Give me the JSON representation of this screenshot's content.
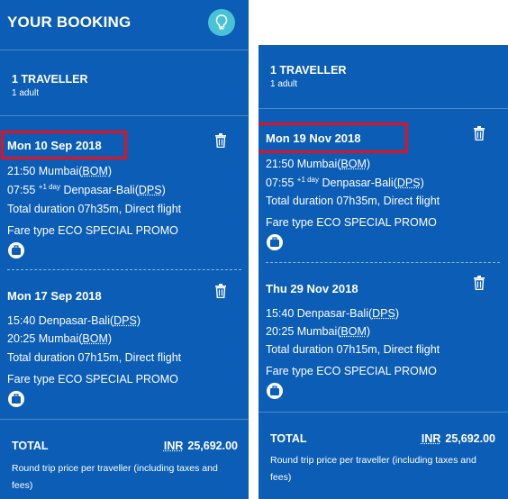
{
  "left": {
    "header": {
      "title": "YOUR BOOKING",
      "icon": "lightbulb-icon"
    },
    "traveller": {
      "count": "1 TRAVELLER",
      "detail": "1 adult"
    },
    "outbound": {
      "date": "Mon 10 Sep 2018",
      "depart_time": "21:50",
      "depart_city": "Mumbai",
      "depart_code": "BOM",
      "arrive_time": "07:55",
      "arrive_day": "+1 day",
      "arrive_city": "Denpasar-Bali",
      "arrive_code": "DPS",
      "duration": "Total duration 07h35m, Direct flight",
      "fare": "Fare type ECO SPECIAL PROMO"
    },
    "return": {
      "date": "Mon 17 Sep 2018",
      "depart_time": "15:40",
      "depart_city": "Denpasar-Bali",
      "depart_code": "DPS",
      "arrive_time": "20:25",
      "arrive_city": "Mumbai",
      "arrive_code": "BOM",
      "duration": "Total duration 07h15m, Direct flight",
      "fare": "Fare type ECO SPECIAL PROMO"
    },
    "total": {
      "label": "TOTAL",
      "currency": "INR",
      "amount": "25,692.00",
      "note": "Round trip price per traveller (including taxes and fees)"
    }
  },
  "right": {
    "traveller": {
      "count": "1 TRAVELLER",
      "detail": "1 adult"
    },
    "outbound": {
      "date": "Mon 19 Nov 2018",
      "depart_time": "21:50",
      "depart_city": "Mumbai",
      "depart_code": "BOM",
      "arrive_time": "07:55",
      "arrive_day": "+1 day",
      "arrive_city": "Denpasar-Bali",
      "arrive_code": "DPS",
      "duration": "Total duration 07h35m, Direct flight",
      "fare": "Fare type ECO SPECIAL PROMO"
    },
    "return": {
      "date": "Thu 29 Nov 2018",
      "depart_time": "15:40",
      "depart_city": "Denpasar-Bali",
      "depart_code": "DPS",
      "arrive_time": "20:25",
      "arrive_city": "Mumbai",
      "arrive_code": "BOM",
      "duration": "Total duration 07h15m, Direct flight",
      "fare": "Fare type ECO SPECIAL PROMO"
    },
    "total": {
      "label": "TOTAL",
      "currency": "INR",
      "amount": "25,692.00",
      "note": "Round trip price per traveller (including taxes and fees)"
    }
  },
  "colors": {
    "panel": "#0c5db6",
    "accent": "#48c3d6",
    "highlight": "#e3101d"
  },
  "icons": {
    "delete": "trash-icon",
    "baggage": "baggage-icon"
  }
}
